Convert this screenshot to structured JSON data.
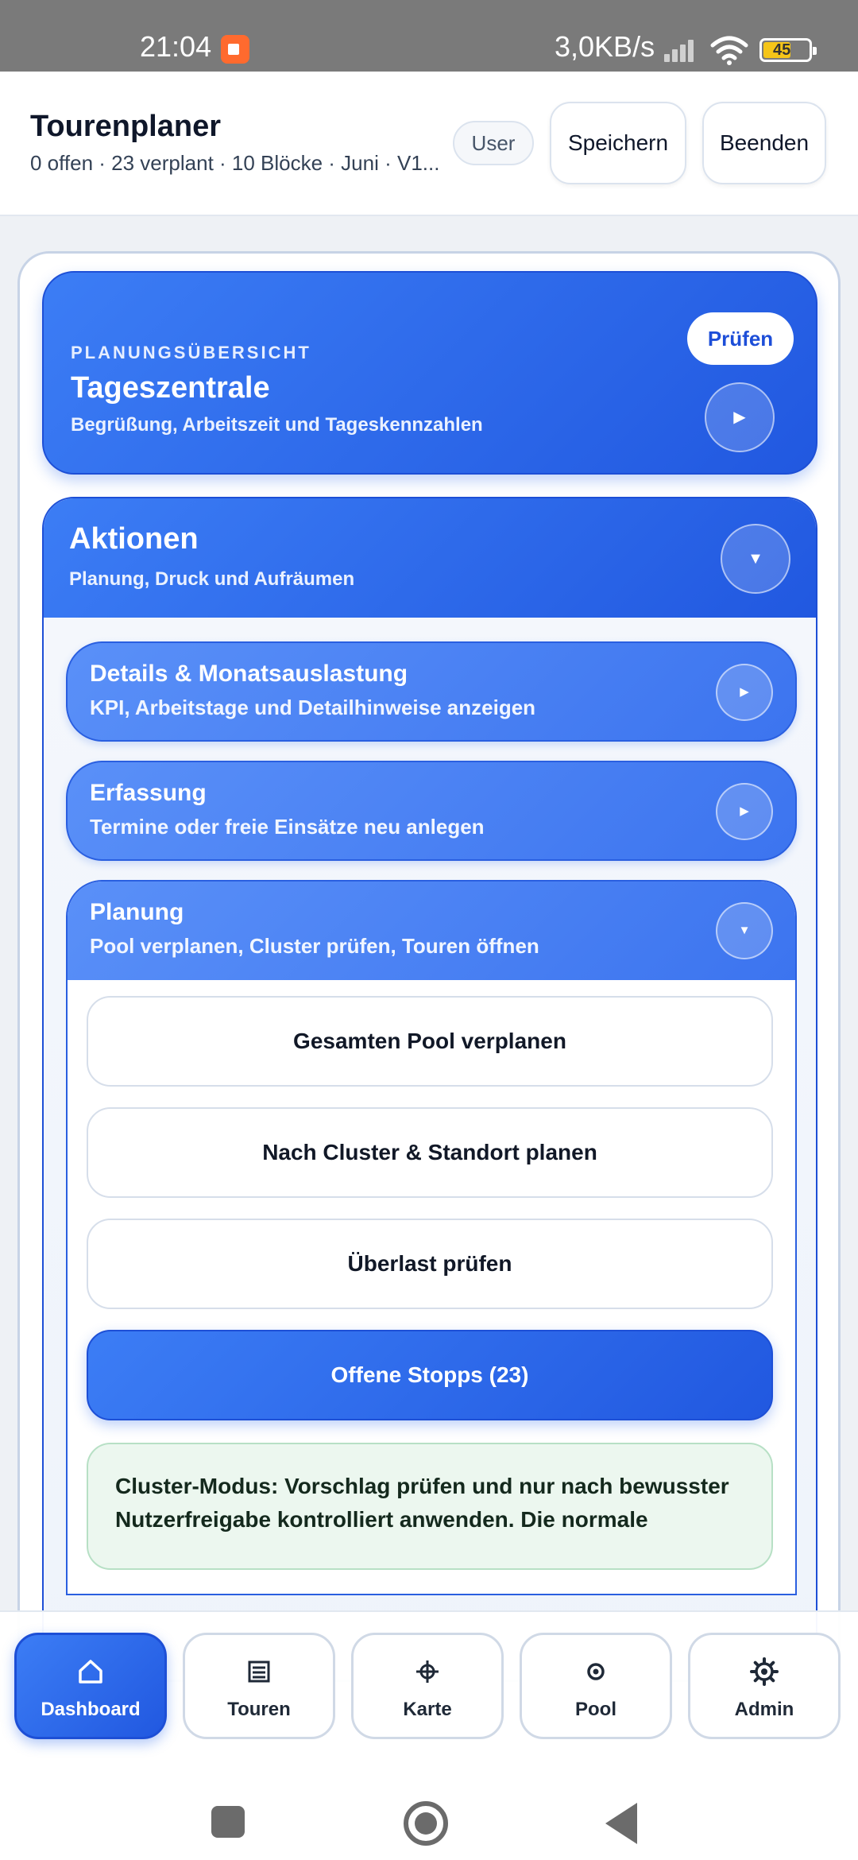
{
  "status_bar": {
    "time": "21:04",
    "network_speed": "3,0KB/s",
    "battery": "45"
  },
  "header": {
    "title": "Tourenplaner",
    "subtitle": "0 offen · 23 verplant · 10 Blöcke · Juni · V1...",
    "user_chip": "User",
    "save_label": "Speichern",
    "quit_label": "Beenden"
  },
  "overview": {
    "eyebrow": "PLANUNGSÜBERSICHT",
    "title": "Tageszentrale",
    "subtitle": "Begrüßung, Arbeitszeit und Tageskennzahlen",
    "check_label": "Prüfen"
  },
  "actions": {
    "title": "Aktionen",
    "subtitle": "Planung, Druck und Aufräumen",
    "sections": [
      {
        "title": "Details & Monatsauslastung",
        "desc": "KPI, Arbeitstage und Detailhinweise anzeigen"
      },
      {
        "title": "Erfassung",
        "desc": "Termine oder freie Einsätze neu anlegen"
      },
      {
        "title": "Planung",
        "desc": "Pool verplanen, Cluster prüfen, Touren öffnen"
      }
    ],
    "planung_buttons": [
      "Gesamten Pool verplanen",
      "Nach Cluster & Standort planen",
      "Überlast prüfen",
      "Offene Stopps (23)"
    ],
    "info_text": "Cluster-Modus: Vorschlag prüfen und nur nach bewusster Nutzerfreigabe kontrolliert anwenden. Die normale"
  },
  "bottom_nav": [
    {
      "label": "Dashboard",
      "icon": "home-icon",
      "active": true
    },
    {
      "label": "Touren",
      "icon": "list-icon",
      "active": false
    },
    {
      "label": "Karte",
      "icon": "crosshair-icon",
      "active": false
    },
    {
      "label": "Pool",
      "icon": "target-icon",
      "active": false
    },
    {
      "label": "Admin",
      "icon": "gear-icon",
      "active": false
    }
  ],
  "colors": {
    "accent": "#2563eb",
    "accent_light": "#4f86f7",
    "info_bg": "#ecf7ef",
    "status_bar": "#7a7a7a"
  }
}
